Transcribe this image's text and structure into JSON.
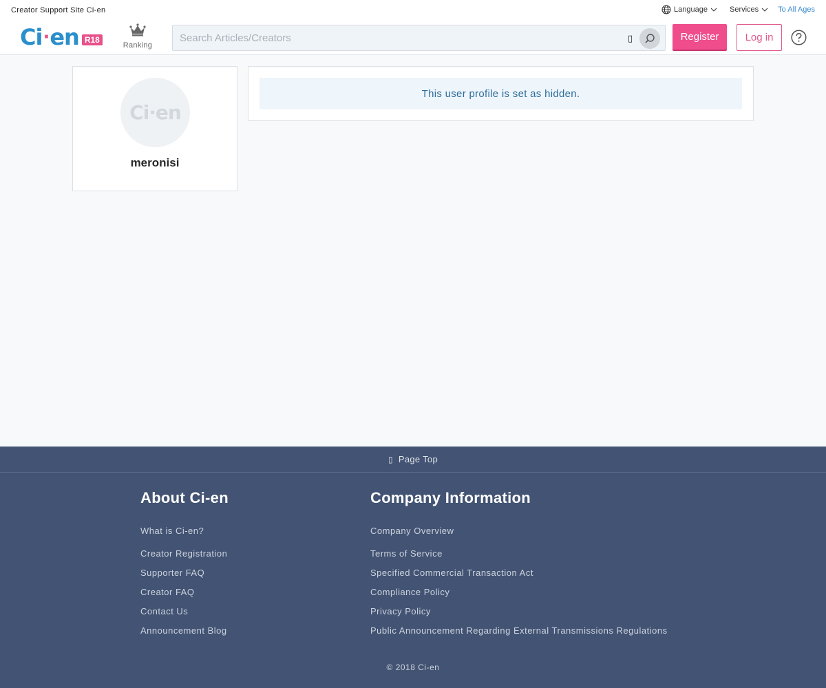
{
  "topbar": {
    "site_name": "Creator Support Site Ci-en",
    "language_label": "Language",
    "services_label": "Services",
    "all_ages_label": "To All Ages"
  },
  "header": {
    "logo_main": "Ci",
    "logo_dot": "·",
    "logo_tail": "en",
    "logo_badge": "R18",
    "ranking_label": "Ranking",
    "search": {
      "placeholder": "Search Articles/Creators",
      "value": ""
    },
    "register_label": "Register",
    "login_label": "Log in"
  },
  "profile": {
    "avatar_text": "Ci·en",
    "username": "meronisi"
  },
  "notice": {
    "message": "This user profile is set as hidden."
  },
  "footer": {
    "page_top_label": "Page Top",
    "about": {
      "heading": "About Ci-en",
      "links": [
        "What is Ci-en?",
        "Creator Registration",
        "Supporter FAQ",
        "Creator FAQ",
        "Contact Us",
        "Announcement Blog"
      ]
    },
    "company": {
      "heading": "Company Information",
      "links": [
        "Company Overview",
        "Terms of Service",
        "Specified Commercial Transaction Act",
        "Compliance Policy",
        "Privacy Policy",
        "Public Announcement Regarding External Transmissions Regulations"
      ]
    },
    "copyright": "© 2018 Ci-en"
  },
  "colors": {
    "brand_blue": "#2b8fcc",
    "brand_pink": "#ef4d8c",
    "footer_bg": "#435373",
    "notice_text": "#2c6d9a"
  },
  "icons": [
    "globe-icon",
    "chevron-down-icon",
    "crown-icon",
    "keyboard-icon",
    "search-icon",
    "help-icon",
    "arrow-up-icon"
  ]
}
